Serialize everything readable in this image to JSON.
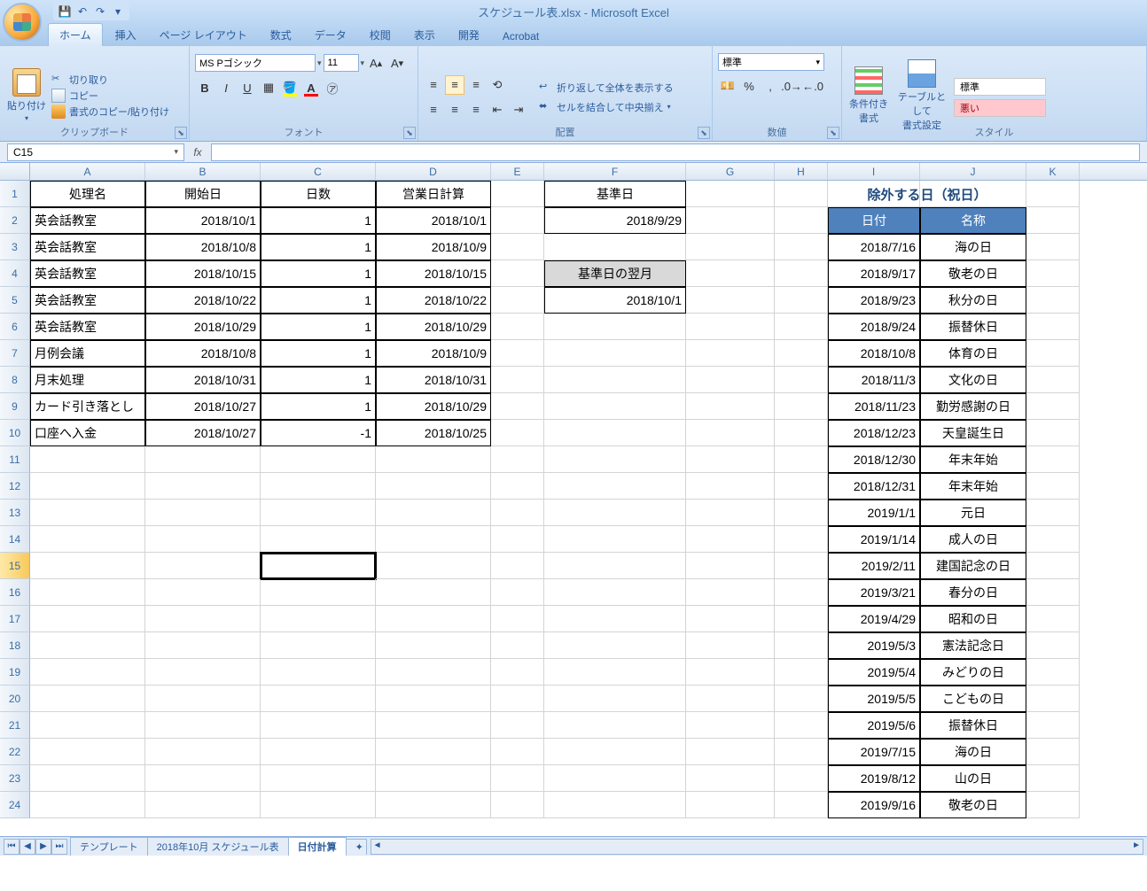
{
  "app": {
    "title": "スケジュール表.xlsx - Microsoft Excel"
  },
  "qat": {
    "save": "save-icon",
    "undo": "undo-icon",
    "redo": "redo-icon"
  },
  "tabs": [
    "ホーム",
    "挿入",
    "ページ レイアウト",
    "数式",
    "データ",
    "校閲",
    "表示",
    "開発",
    "Acrobat"
  ],
  "active_tab": 0,
  "ribbon": {
    "clipboard": {
      "title": "クリップボード",
      "paste": "貼り付け",
      "cut": "切り取り",
      "copy": "コピー",
      "painter": "書式のコピー/貼り付け"
    },
    "font": {
      "title": "フォント",
      "name": "MS Pゴシック",
      "size": "11"
    },
    "align": {
      "title": "配置",
      "wrap": "折り返して全体を表示する",
      "merge": "セルを結合して中央揃え"
    },
    "number": {
      "title": "数値",
      "format": "標準"
    },
    "styles": {
      "title": "スタイル",
      "cond": "条件付き\n書式",
      "table": "テーブルとして\n書式設定",
      "normal": "標準",
      "bad": "悪い"
    }
  },
  "name_box": "C15",
  "formula": "",
  "columns": [
    "A",
    "B",
    "C",
    "D",
    "E",
    "F",
    "G",
    "H",
    "I",
    "J",
    "K"
  ],
  "row_count": 24,
  "selected_row": 15,
  "selected_cell": {
    "row": 15,
    "col": "C"
  },
  "main_headers": {
    "r1": {
      "A": "処理名",
      "B": "開始日",
      "C": "日数",
      "D": "営業日計算"
    }
  },
  "main_data": [
    {
      "A": "英会話教室",
      "B": "2018/10/1",
      "C": "1",
      "D": "2018/10/1"
    },
    {
      "A": "英会話教室",
      "B": "2018/10/8",
      "C": "1",
      "D": "2018/10/9"
    },
    {
      "A": "英会話教室",
      "B": "2018/10/15",
      "C": "1",
      "D": "2018/10/15"
    },
    {
      "A": "英会話教室",
      "B": "2018/10/22",
      "C": "1",
      "D": "2018/10/22"
    },
    {
      "A": "英会話教室",
      "B": "2018/10/29",
      "C": "1",
      "D": "2018/10/29"
    },
    {
      "A": "月例会議",
      "B": "2018/10/8",
      "C": "1",
      "D": "2018/10/9"
    },
    {
      "A": "月末処理",
      "B": "2018/10/31",
      "C": "1",
      "D": "2018/10/31"
    },
    {
      "A": "カード引き落とし",
      "B": "2018/10/27",
      "C": "1",
      "D": "2018/10/29"
    },
    {
      "A": "口座へ入金",
      "B": "2018/10/27",
      "C": "-1",
      "D": "2018/10/25"
    }
  ],
  "ref": {
    "F1": "基準日",
    "F2": "2018/9/29",
    "F4": "基準日の翌月",
    "F5": "2018/10/1"
  },
  "holiday_title": "除外する日（祝日）",
  "holiday_headers": {
    "I": "日付",
    "J": "名称"
  },
  "holidays": [
    {
      "I": "2018/7/16",
      "J": "海の日"
    },
    {
      "I": "2018/9/17",
      "J": "敬老の日"
    },
    {
      "I": "2018/9/23",
      "J": "秋分の日"
    },
    {
      "I": "2018/9/24",
      "J": "振替休日"
    },
    {
      "I": "2018/10/8",
      "J": "体育の日"
    },
    {
      "I": "2018/11/3",
      "J": "文化の日"
    },
    {
      "I": "2018/11/23",
      "J": "勤労感謝の日"
    },
    {
      "I": "2018/12/23",
      "J": "天皇誕生日"
    },
    {
      "I": "2018/12/30",
      "J": "年末年始"
    },
    {
      "I": "2018/12/31",
      "J": "年末年始"
    },
    {
      "I": "2019/1/1",
      "J": "元日"
    },
    {
      "I": "2019/1/14",
      "J": "成人の日"
    },
    {
      "I": "2019/2/11",
      "J": "建国記念の日"
    },
    {
      "I": "2019/3/21",
      "J": "春分の日"
    },
    {
      "I": "2019/4/29",
      "J": "昭和の日"
    },
    {
      "I": "2019/5/3",
      "J": "憲法記念日"
    },
    {
      "I": "2019/5/4",
      "J": "みどりの日"
    },
    {
      "I": "2019/5/5",
      "J": "こどもの日"
    },
    {
      "I": "2019/5/6",
      "J": "振替休日"
    },
    {
      "I": "2019/7/15",
      "J": "海の日"
    },
    {
      "I": "2019/8/12",
      "J": "山の日"
    },
    {
      "I": "2019/9/16",
      "J": "敬老の日"
    }
  ],
  "sheets": [
    "テンプレート",
    "2018年10月 スケジュール表",
    "日付計算"
  ],
  "active_sheet": 2
}
